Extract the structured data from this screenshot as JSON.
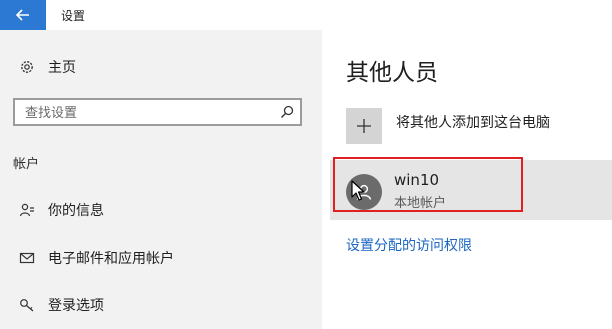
{
  "window": {
    "title": "设置"
  },
  "sidebar": {
    "home_label": "主页",
    "search_placeholder": "查找设置",
    "section_header": "帐户",
    "items": [
      {
        "label": "你的信息",
        "icon": "person-icon"
      },
      {
        "label": "电子邮件和应用帐户",
        "icon": "mail-icon"
      },
      {
        "label": "登录选项",
        "icon": "key-icon"
      }
    ]
  },
  "main": {
    "title": "其他人员",
    "add_label": "将其他人添加到这台电脑",
    "account": {
      "name": "win10",
      "type": "本地帐户"
    },
    "link": "设置分配的访问权限"
  },
  "colors": {
    "accent": "#2b79d3",
    "link": "#1a66c2",
    "highlight": "#e02020",
    "sidebar_bg": "#f2f2f2"
  }
}
